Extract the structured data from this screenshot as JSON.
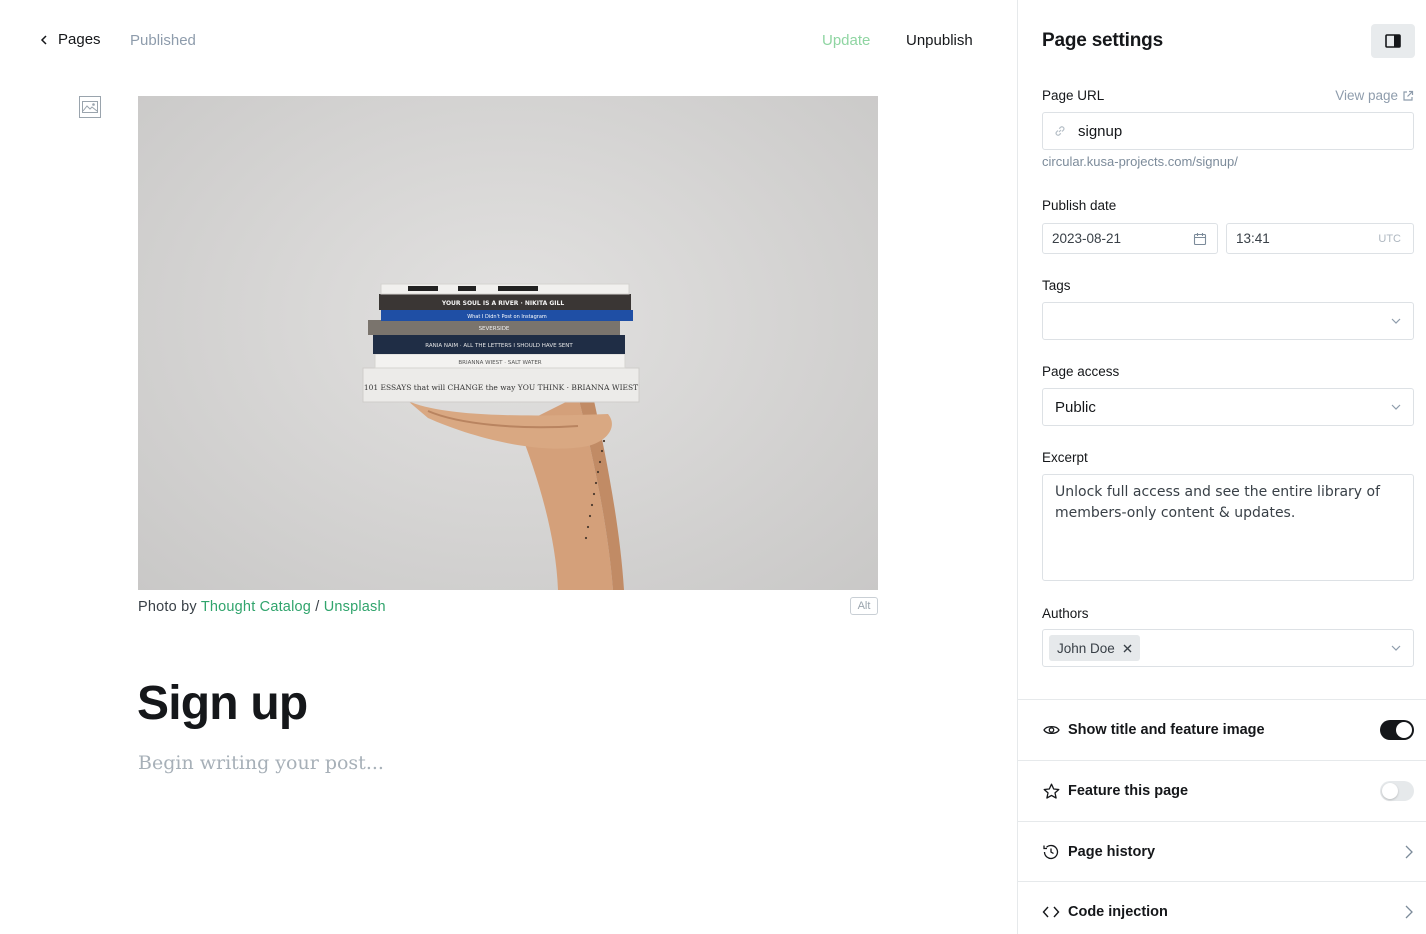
{
  "editor": {
    "back_label": "Pages",
    "status": "Published",
    "update_label": "Update",
    "unpublish_label": "Unpublish",
    "caption_prefix": "Photo by ",
    "caption_author": "Thought Catalog",
    "caption_sep": " / ",
    "caption_source": "Unsplash",
    "alt_label": "Alt",
    "title": "Sign up",
    "body_placeholder": "Begin writing your post..."
  },
  "feature_image": {
    "book_spines": [
      "YOUR SOUL IS A RIVER · NIKITA GILL",
      "What I Didn't Post on Instagram",
      "SEVERSIDE",
      "RANIA NAIM · ALL THE LETTERS I SHOULD HAVE SENT",
      "BRIANNA WIEST · SALT WATER",
      "101 ESSAYS that will CHANGE the way YOU THINK · BRIANNA WIEST"
    ]
  },
  "settings": {
    "title": "Page settings",
    "url_label": "Page URL",
    "view_page_label": "View page",
    "url_value": "signup",
    "url_hint": "circular.kusa-projects.com/signup/",
    "publish_date_label": "Publish date",
    "date_value": "2023-08-21",
    "time_value": "13:41",
    "timezone": "UTC",
    "tags_label": "Tags",
    "access_label": "Page access",
    "access_value": "Public",
    "excerpt_label": "Excerpt",
    "excerpt_value": "Unlock full access and see the entire library of members-only content & updates.",
    "authors_label": "Authors",
    "authors": [
      "John Doe"
    ],
    "show_title_label": "Show title and feature image",
    "show_title_on": true,
    "feature_label": "Feature this page",
    "feature_on": false,
    "history_label": "Page history",
    "code_injection_label": "Code injection"
  },
  "colors": {
    "accent_green": "#30a46c",
    "update_green": "#8fd5a2",
    "text_dark": "#15171a",
    "muted": "#8e9cac"
  }
}
